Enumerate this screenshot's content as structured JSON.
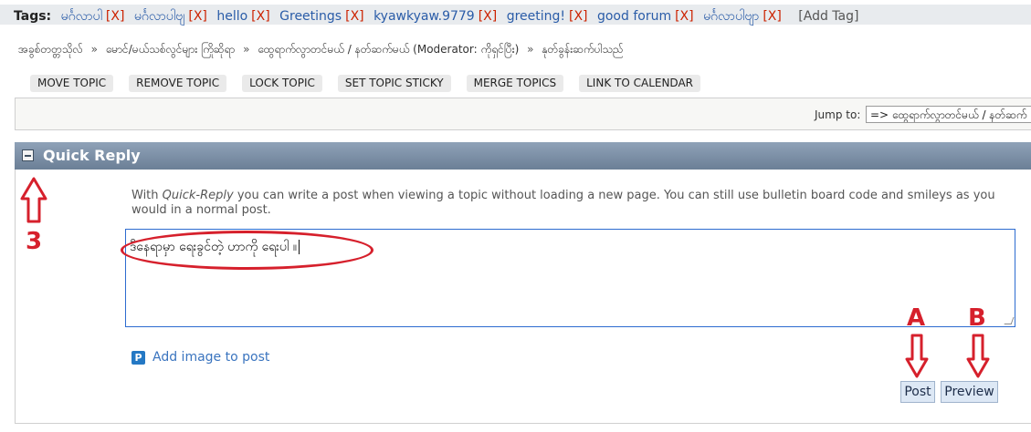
{
  "tags": {
    "label": "Tags:",
    "items": [
      {
        "text": "မင်္ဂလာပါ",
        "remove": "[X]"
      },
      {
        "text": "မင်္ဂလာပါဗျ",
        "remove": "[X]"
      },
      {
        "text": "hello",
        "remove": "[X]"
      },
      {
        "text": "Greetings",
        "remove": "[X]"
      },
      {
        "text": "kyawkyaw.9779",
        "remove": "[X]"
      },
      {
        "text": "greeting!",
        "remove": "[X]"
      },
      {
        "text": "good forum",
        "remove": "[X]"
      },
      {
        "text": "မင်္ဂလာပါဗျာ",
        "remove": "[X]"
      }
    ],
    "add_label": "[Add Tag]"
  },
  "breadcrumb": {
    "items": [
      "အခွစ်တတ္တသိုလ်",
      "မောင်/မယ်သစ်လွင်များ ကြိုဆိုရာ",
      "ထွေရာက်လွာတင်မယ် / နတ်ဆက်မယ် (Moderator: ကိုရှင်ပြီး)",
      "နုတ်ခွန်းဆက်ပါသည်"
    ],
    "separator": "»"
  },
  "moderation": {
    "buttons": [
      "MOVE TOPIC",
      "REMOVE TOPIC",
      "LOCK TOPIC",
      "SET TOPIC STICKY",
      "MERGE TOPICS",
      "LINK TO CALENDAR"
    ]
  },
  "jump": {
    "label": "Jump to:",
    "selected": "=> ထွေရာက်လွာတင်မယ် / နတ်ဆက်"
  },
  "quick_reply": {
    "title": "Quick Reply",
    "info_prefix": "With ",
    "info_emphasis": "Quick-Reply",
    "info_suffix": " you can write a post when viewing a topic without loading a new page. You can still use bulletin board code and smileys as you would in a normal post.",
    "message_value": "ဒီနေရာမှာ ရေးခွင်တဲ့ ဟာကို ရေးပါ ။",
    "add_image_label": "Add image to post",
    "add_image_icon_glyph": "P",
    "post_label": "Post",
    "preview_label": "Preview"
  },
  "annotations": {
    "label_3": "3",
    "label_a": "A",
    "label_b": "B",
    "color": "#d6202c"
  }
}
